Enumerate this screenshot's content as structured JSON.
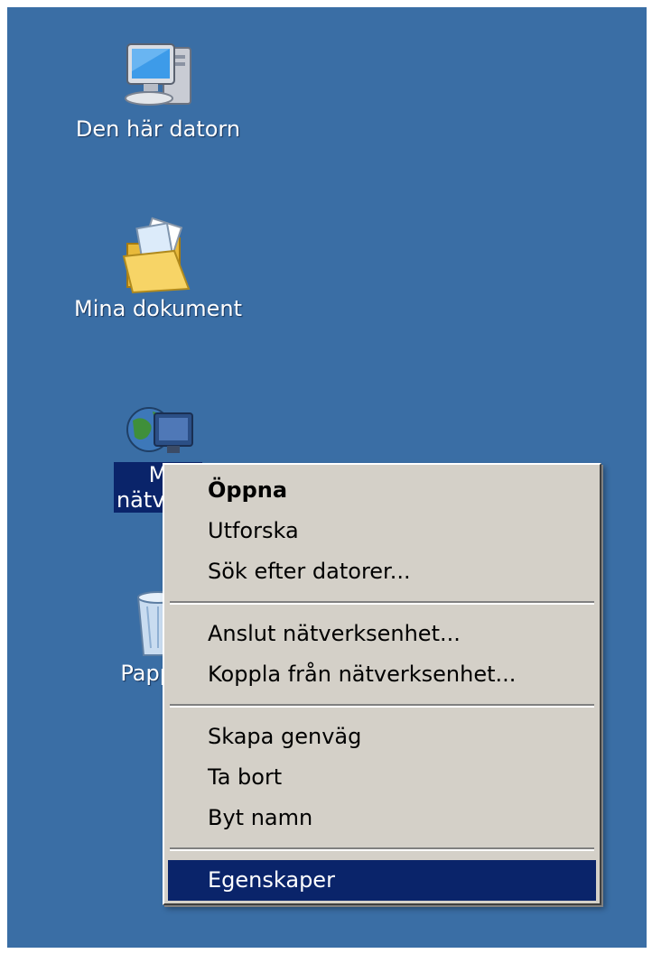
{
  "desktop": {
    "background_color": "#3a6ea5",
    "selection_color": "#0a246a",
    "icons": [
      {
        "name": "computer-icon",
        "label": "Den här datorn"
      },
      {
        "name": "documents-folder-icon",
        "label": "Mina dokument"
      },
      {
        "name": "network-places-icon",
        "label": "Mina\nnätverksplatser",
        "visible_label": "M\nnätverk",
        "selected": true
      },
      {
        "name": "recycle-bin-icon",
        "label": "Pappers",
        "visible_label": "Papper"
      }
    ]
  },
  "context_menu": {
    "groups": [
      {
        "items": [
          {
            "label": "Öppna",
            "default": true
          },
          {
            "label": "Utforska"
          },
          {
            "label": "Sök efter datorer..."
          }
        ]
      },
      {
        "items": [
          {
            "label": "Anslut nätverksenhet..."
          },
          {
            "label": "Koppla från nätverksenhet..."
          }
        ]
      },
      {
        "items": [
          {
            "label": "Skapa genväg"
          },
          {
            "label": "Ta bort"
          },
          {
            "label": "Byt namn"
          }
        ]
      },
      {
        "items": [
          {
            "label": "Egenskaper",
            "highlighted": true
          }
        ]
      }
    ]
  }
}
